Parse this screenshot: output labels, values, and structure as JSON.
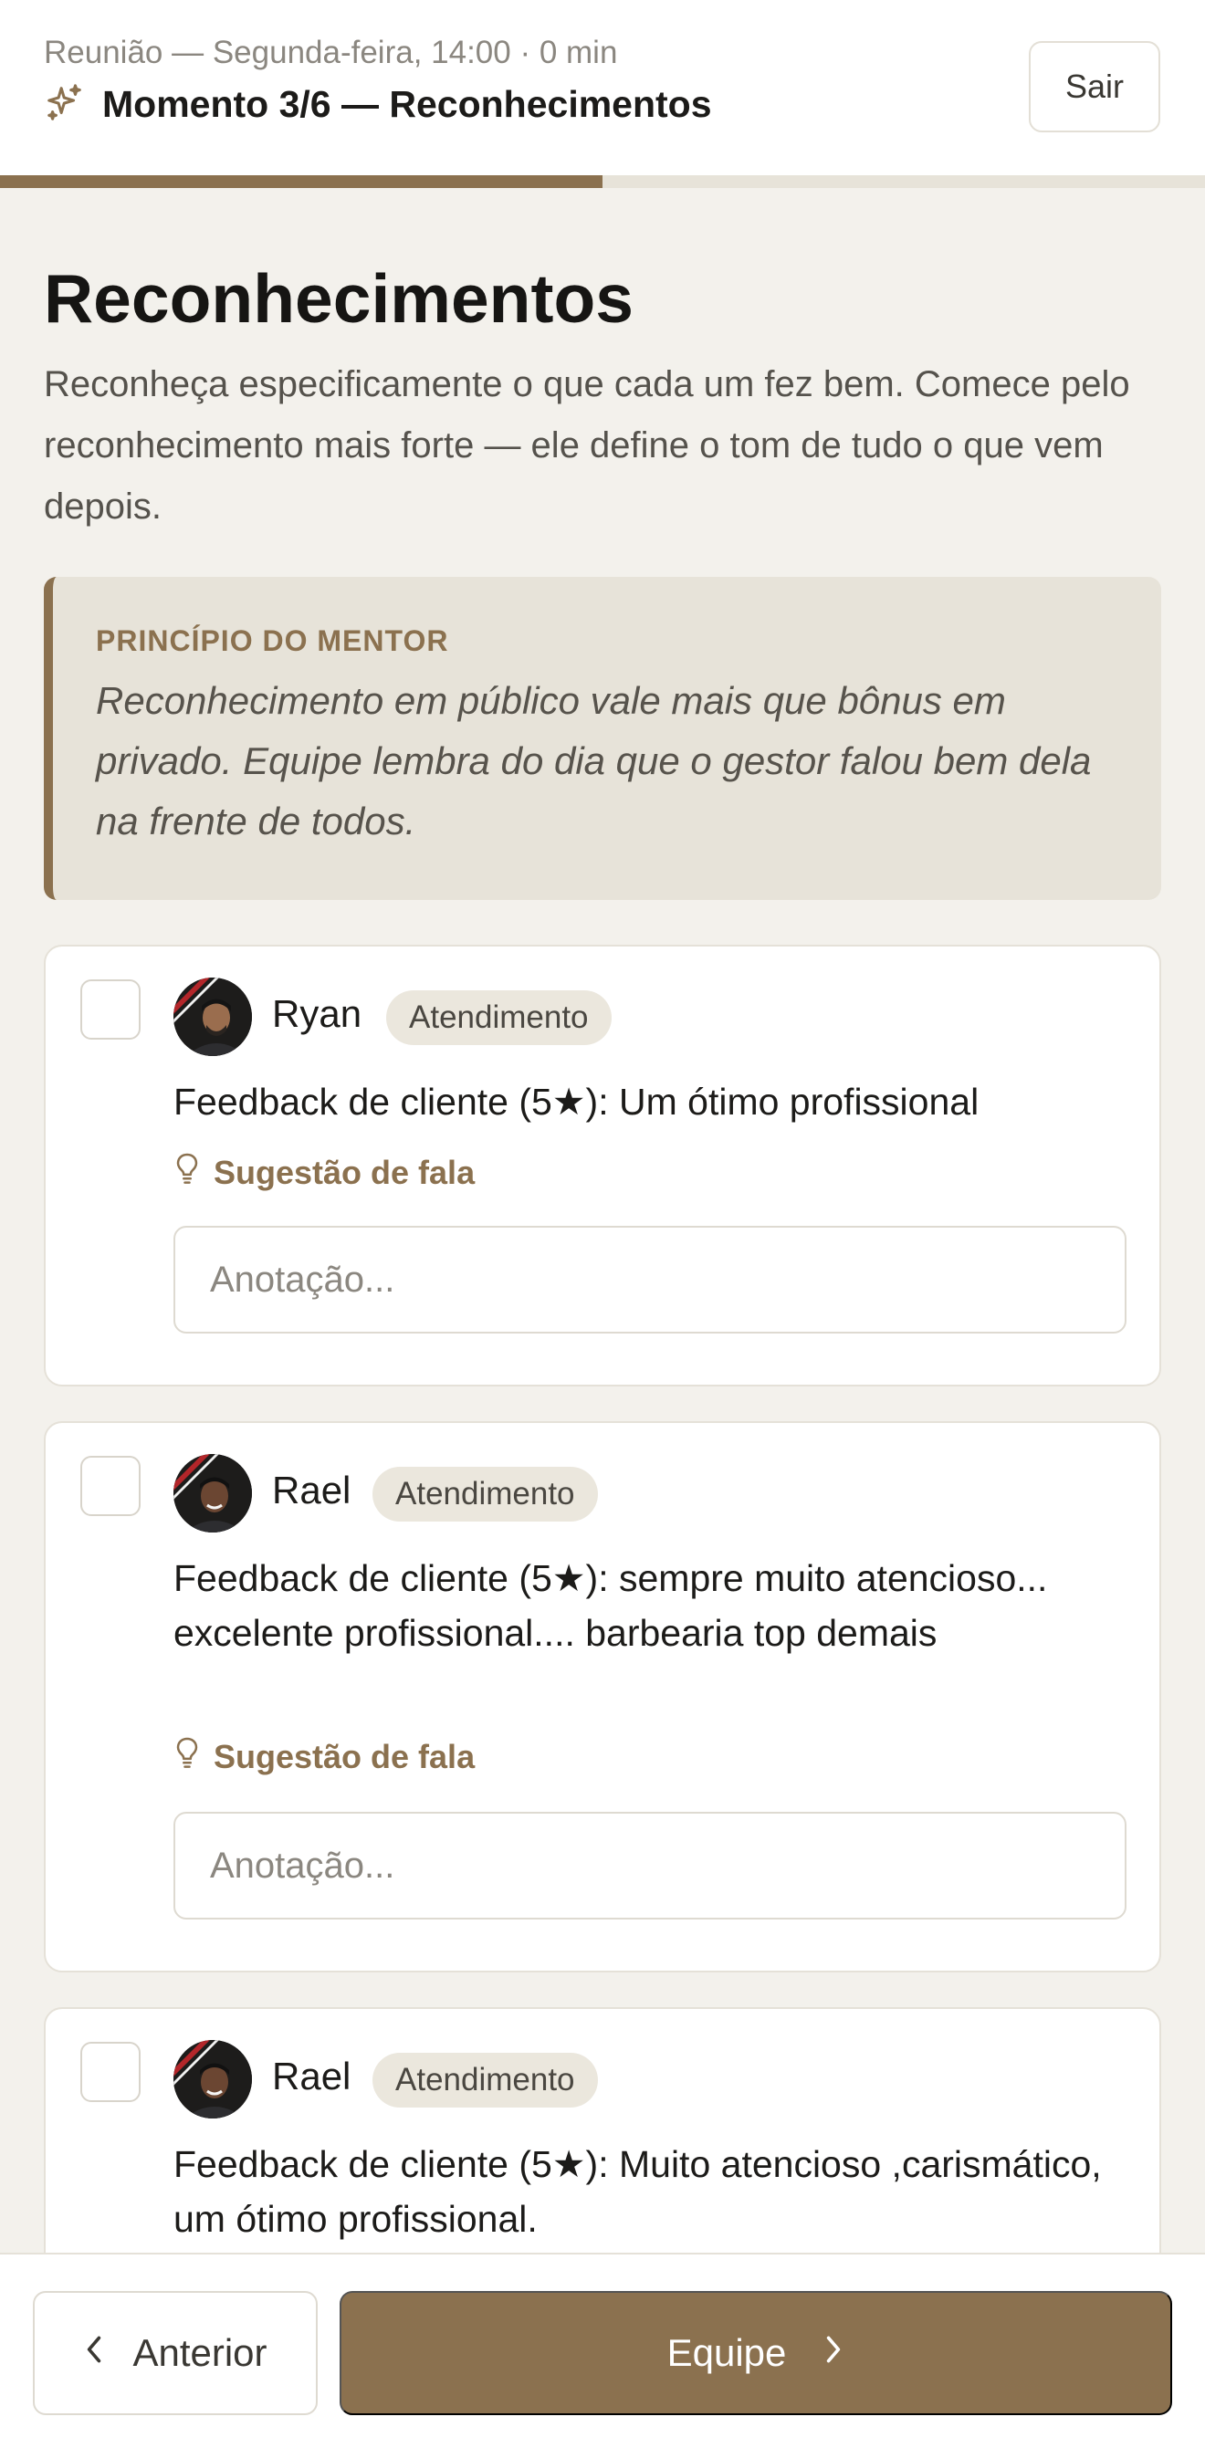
{
  "header": {
    "meeting_line": "Reunião — Segunda-feira, 14:00 · 0 min",
    "moment_title": "Momento 3/6 — Reconhecimentos",
    "exit_label": "Sair",
    "progress_fraction": 0.5
  },
  "main": {
    "title": "Reconhecimentos",
    "description": "Reconheça especificamente o que cada um fez bem. Comece pelo reconhecimento mais forte — ele define o tom de tudo o que vem depois.",
    "mentor": {
      "label": "PRINCÍPIO DO MENTOR",
      "quote": "Reconhecimento em público vale mais que bônus em privado. Equipe lembra do dia que o gestor falou bem dela na frente de todos."
    },
    "cards": [
      {
        "name": "Ryan",
        "role": "Atendimento",
        "text": "Feedback de cliente (5★): Um ótimo profissional",
        "suggestion": "Sugestão de fala",
        "note_placeholder": "Anotação...",
        "checked": false
      },
      {
        "name": "Rael",
        "role": "Atendimento",
        "text": "Feedback de cliente (5★): sempre muito atencioso... excelente profissional.... barbearia top demais",
        "suggestion": "Sugestão de fala",
        "note_placeholder": "Anotação...",
        "checked": false
      },
      {
        "name": "Rael",
        "role": "Atendimento",
        "text": "Feedback de cliente (5★): Muito atencioso ,carismático, um ótimo profissional.",
        "checked": false
      }
    ]
  },
  "footer": {
    "prev_label": "Anterior",
    "next_label": "Equipe"
  },
  "colors": {
    "accent": "#8b714f",
    "background": "#f3f1ec",
    "mentor_bg": "#e7e3d9"
  }
}
